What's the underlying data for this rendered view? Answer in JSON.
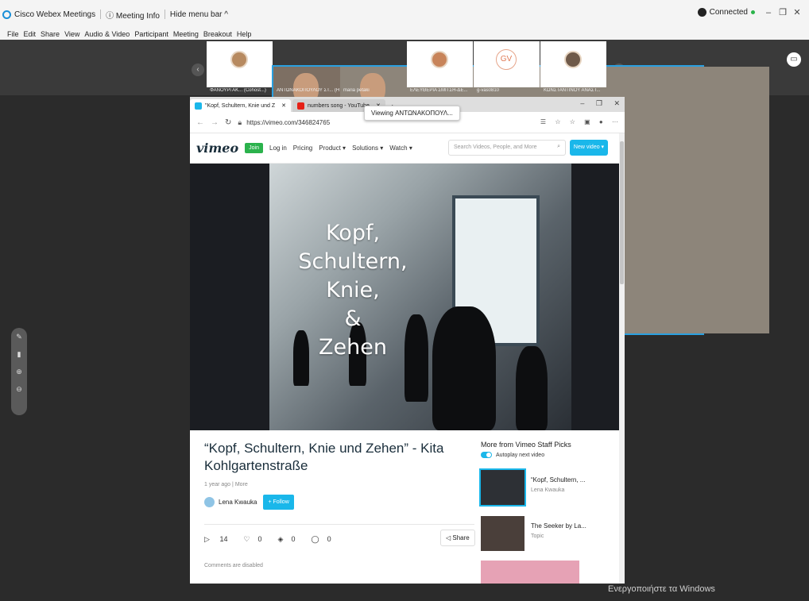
{
  "webex": {
    "app_title": "Cisco Webex Meetings",
    "meeting_info": "Meeting Info",
    "hide_menu": "Hide menu bar ^",
    "status": "Connected",
    "menu": [
      "File",
      "Edit",
      "Share",
      "View",
      "Audio & Video",
      "Participant",
      "Meeting",
      "Breakout",
      "Help"
    ]
  },
  "participants": [
    {
      "label": "ΦΑΝΟΥΡΓΑΚ... (Cohost...)",
      "kind": "avatar"
    },
    {
      "label": "ΑΝΤΩΝΑΚΟΠΟΥΛΟΥ ΣΤ... (Host)",
      "kind": "video"
    },
    {
      "label": "maria petaki",
      "kind": "video"
    },
    {
      "label": "ΕΛΕΥΘΕΡΙΑ ΣΜΙΤΣΗ-ΔΕ...",
      "kind": "avatar"
    },
    {
      "label": "g-vas0810",
      "kind": "initials",
      "initials": "GV"
    },
    {
      "label": "ΚΩΝΣΤΑΝΤΙΝΟΥ ΑΝΑΣΤ...",
      "kind": "avatar"
    }
  ],
  "browser": {
    "tabs": [
      {
        "label": "\"Kopf, Schultern, Knie und Z",
        "icon": "vimeo-icon"
      },
      {
        "label": "numbers song - YouTube",
        "icon": "youtube-icon"
      }
    ],
    "url": "https://vimeo.com/346824765",
    "viewing_badge": "Viewing ΑΝΤΩΝΑΚΟΠΟΥΛ..."
  },
  "vimeo": {
    "logo": "vimeo",
    "join": "Join",
    "nav": [
      "Log in",
      "Pricing",
      "Product ▾",
      "Solutions ▾",
      "Watch ▾"
    ],
    "search_placeholder": "Search Videos, People, and More",
    "new_video": "New video ▾",
    "overlay_lines": [
      "Kopf,",
      "Schultern,",
      "Knie,",
      "&",
      "Zehen"
    ],
    "title": "“Kopf, Schultern, Knie und Zehen” - Kita Kohlgartenstraße",
    "meta_age": "1 year ago",
    "meta_more": "More",
    "author": "Lena Kwauka",
    "follow": "+ Follow",
    "stats": {
      "plays": "14",
      "likes": "0",
      "collections": "0",
      "comments": "0"
    },
    "share": "Share",
    "comments_disabled": "Comments are disabled",
    "rail_title": "More from Vimeo Staff Picks",
    "autoplay": "Autoplay next video",
    "recs": [
      {
        "title": "“Kopf, Schultern, ...",
        "sub": "Lena Kwauka"
      },
      {
        "title": "The Seeker by La...",
        "sub": "Topic"
      }
    ]
  },
  "os": {
    "activate_windows": "Ενεργοποιήστε τα Windows"
  }
}
